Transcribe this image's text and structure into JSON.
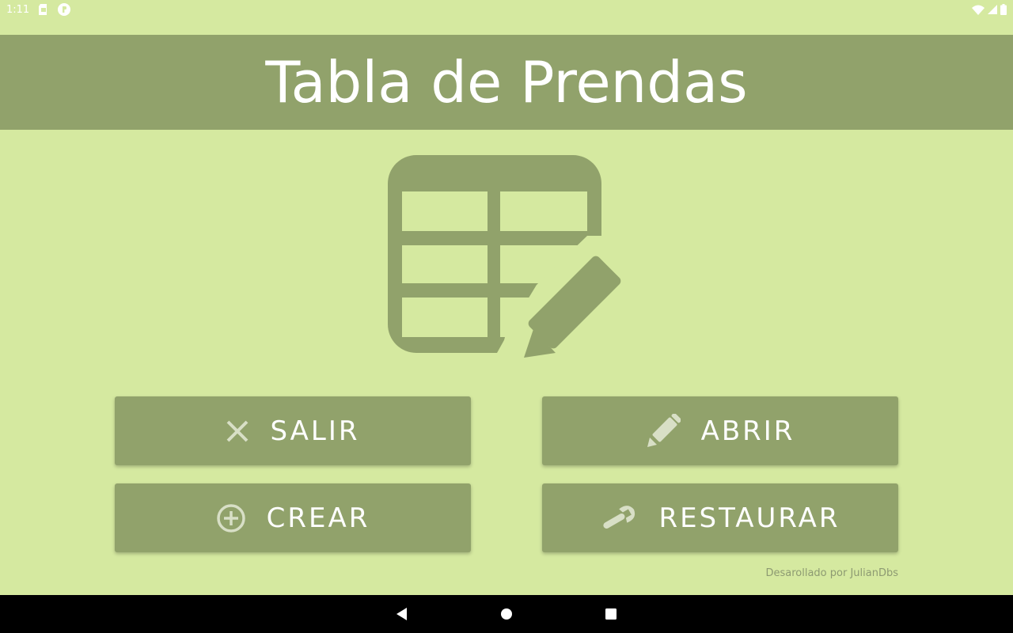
{
  "status_bar": {
    "time": "1:11",
    "left_icons": [
      "sd-card-icon",
      "notification-app-icon"
    ],
    "right_icons": [
      "wifi-icon",
      "signal-icon",
      "battery-icon"
    ]
  },
  "header": {
    "title": "Tabla de Prendas"
  },
  "hero": {
    "icon": "table-edit-icon"
  },
  "buttons": {
    "salir": {
      "label": "SALIR",
      "icon": "close-icon"
    },
    "abrir": {
      "label": "ABRIR",
      "icon": "pencil-icon"
    },
    "crear": {
      "label": "CREAR",
      "icon": "add-circle-icon"
    },
    "restaurar": {
      "label": "RESTAURAR",
      "icon": "wrench-icon"
    }
  },
  "footer": {
    "credit": "Desarollado por JulianDbs"
  },
  "nav_bar": {
    "icons": [
      "back-icon",
      "home-icon",
      "recents-icon"
    ]
  },
  "colors": {
    "background": "#d5e9a0",
    "primary": "#91a26b",
    "text_on_primary": "#ffffff",
    "icon_on_primary": "#d8dfc6",
    "credit_text": "#8d9a72",
    "nav_bar": "#000000"
  }
}
